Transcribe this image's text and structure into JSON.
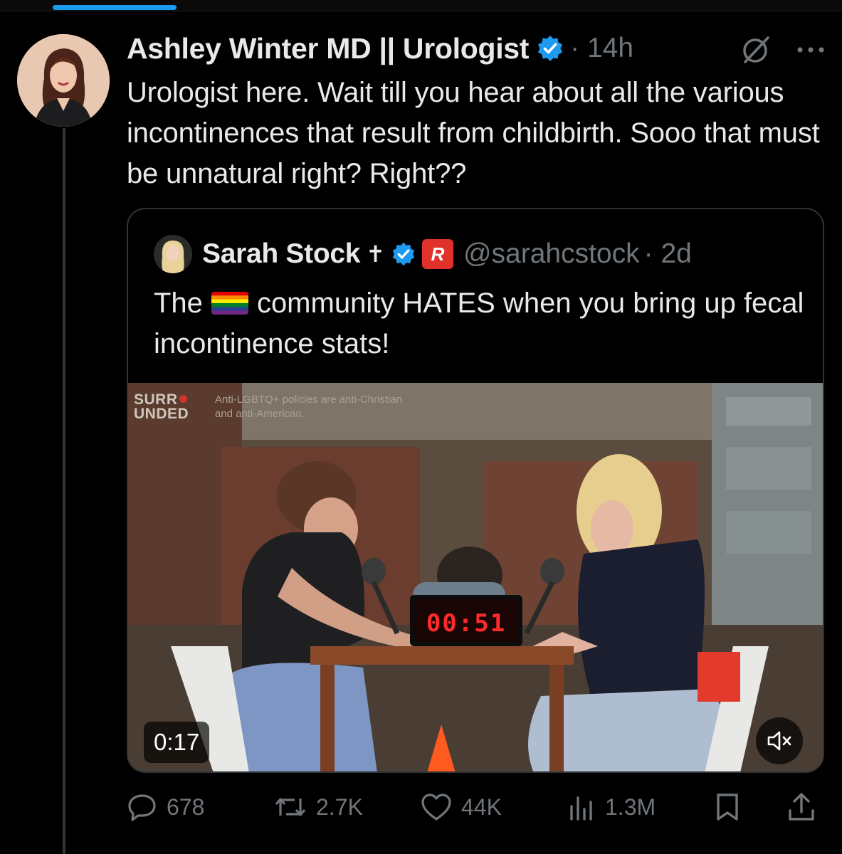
{
  "post": {
    "author_name": "Ashley Winter MD || Urologist",
    "timestamp": "· 14h",
    "text": "Urologist here. Wait till you hear about all the various incontinences that result from childbirth. Sooo that must be unnatural right? Right??",
    "avatar_icon": "author-avatar-photo"
  },
  "quoted": {
    "author_name": "Sarah Stock",
    "name_glyph": "✝",
    "badge_letter": "R",
    "handle": "@sarahcstock",
    "timestamp": "· 2d",
    "text_before_flag": "The",
    "flag_icon": "rainbow-flag-emoji",
    "text_after_flag": "community HATES when you bring up fecal incontinence stats!",
    "video": {
      "logo_line1": "SURR",
      "logo_line2": "UNDED",
      "caption_line1": "Anti-LGBTQ+ policies are anti-Christian",
      "caption_line2": "and anti-American.",
      "timer_display": "00:51",
      "duration": "0:17",
      "mute_icon": "speaker-muted-icon"
    }
  },
  "actions": {
    "replies": "678",
    "reposts": "2.7K",
    "likes": "44K",
    "views": "1.3M"
  },
  "colors": {
    "background": "#000000",
    "text": "#e7e9ea",
    "muted": "#71767b",
    "accent": "#1d9bf0",
    "border": "#2f3336"
  }
}
